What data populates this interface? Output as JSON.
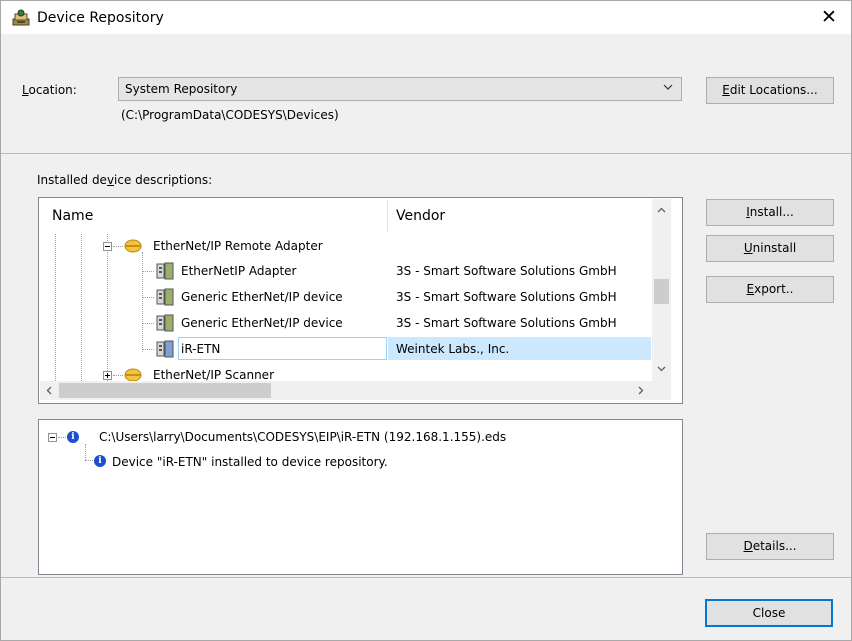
{
  "window": {
    "title": "Device Repository",
    "close_glyph": "✕"
  },
  "location": {
    "label_prefix": "L",
    "label_rest": "ocation:",
    "selected": "System Repository",
    "path": "(C:\\ProgramData\\CODESYS\\Devices)",
    "edit_button_prefix": "E",
    "edit_button_rest": "dit Locations..."
  },
  "installed": {
    "label_pre": "Installed de",
    "label_u": "v",
    "label_post": "ice descriptions:",
    "columns": {
      "name": "Name",
      "vendor": "Vendor"
    },
    "rows": [
      {
        "name": "EtherNet/IP Remote Adapter",
        "vendor": ""
      },
      {
        "name": "EtherNetIP Adapter",
        "vendor": "3S - Smart Software Solutions GmbH"
      },
      {
        "name": "Generic EtherNet/IP device",
        "vendor": "3S - Smart Software Solutions GmbH"
      },
      {
        "name": "Generic EtherNet/IP device",
        "vendor": "3S - Smart Software Solutions GmbH"
      },
      {
        "name": "iR-ETN",
        "vendor": "Weintek Labs., Inc."
      },
      {
        "name": "EtherNet/IP Scanner",
        "vendor": ""
      }
    ],
    "selected_row": "iR-ETN"
  },
  "buttons": {
    "install_u": "I",
    "install_rest": "nstall...",
    "uninstall_u": "U",
    "uninstall_rest": "ninstall",
    "export_u": "E",
    "export_rest": "xport..",
    "details_u": "D",
    "details_rest": "etails...",
    "close": "Close"
  },
  "log": {
    "file": "C:\\Users\\larry\\Documents\\CODESYS\\EIP\\iR-ETN (192.168.1.155).eds",
    "message": "Device \"iR-ETN\" installed to device repository."
  },
  "colors": {
    "selection": "#cce8ff",
    "selection_border": "#99d1ff",
    "info_blue": "#1c4fd0",
    "folder_yellow": "#f5c242"
  }
}
